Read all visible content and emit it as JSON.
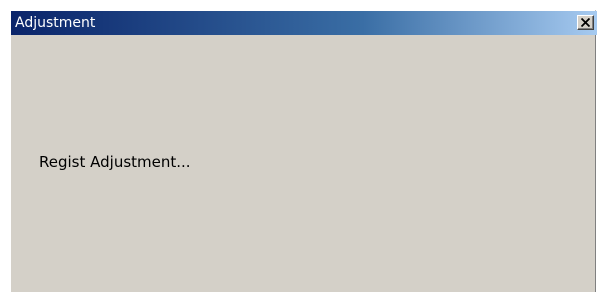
{
  "window": {
    "title": "Adjustment",
    "close_icon": "close-icon",
    "message": "Regist Adjustment..."
  },
  "colors": {
    "titlebar_start": "#0a246a",
    "titlebar_end": "#a6caf0",
    "window_background": "#d4d0c8",
    "title_text": "#ffffff"
  }
}
